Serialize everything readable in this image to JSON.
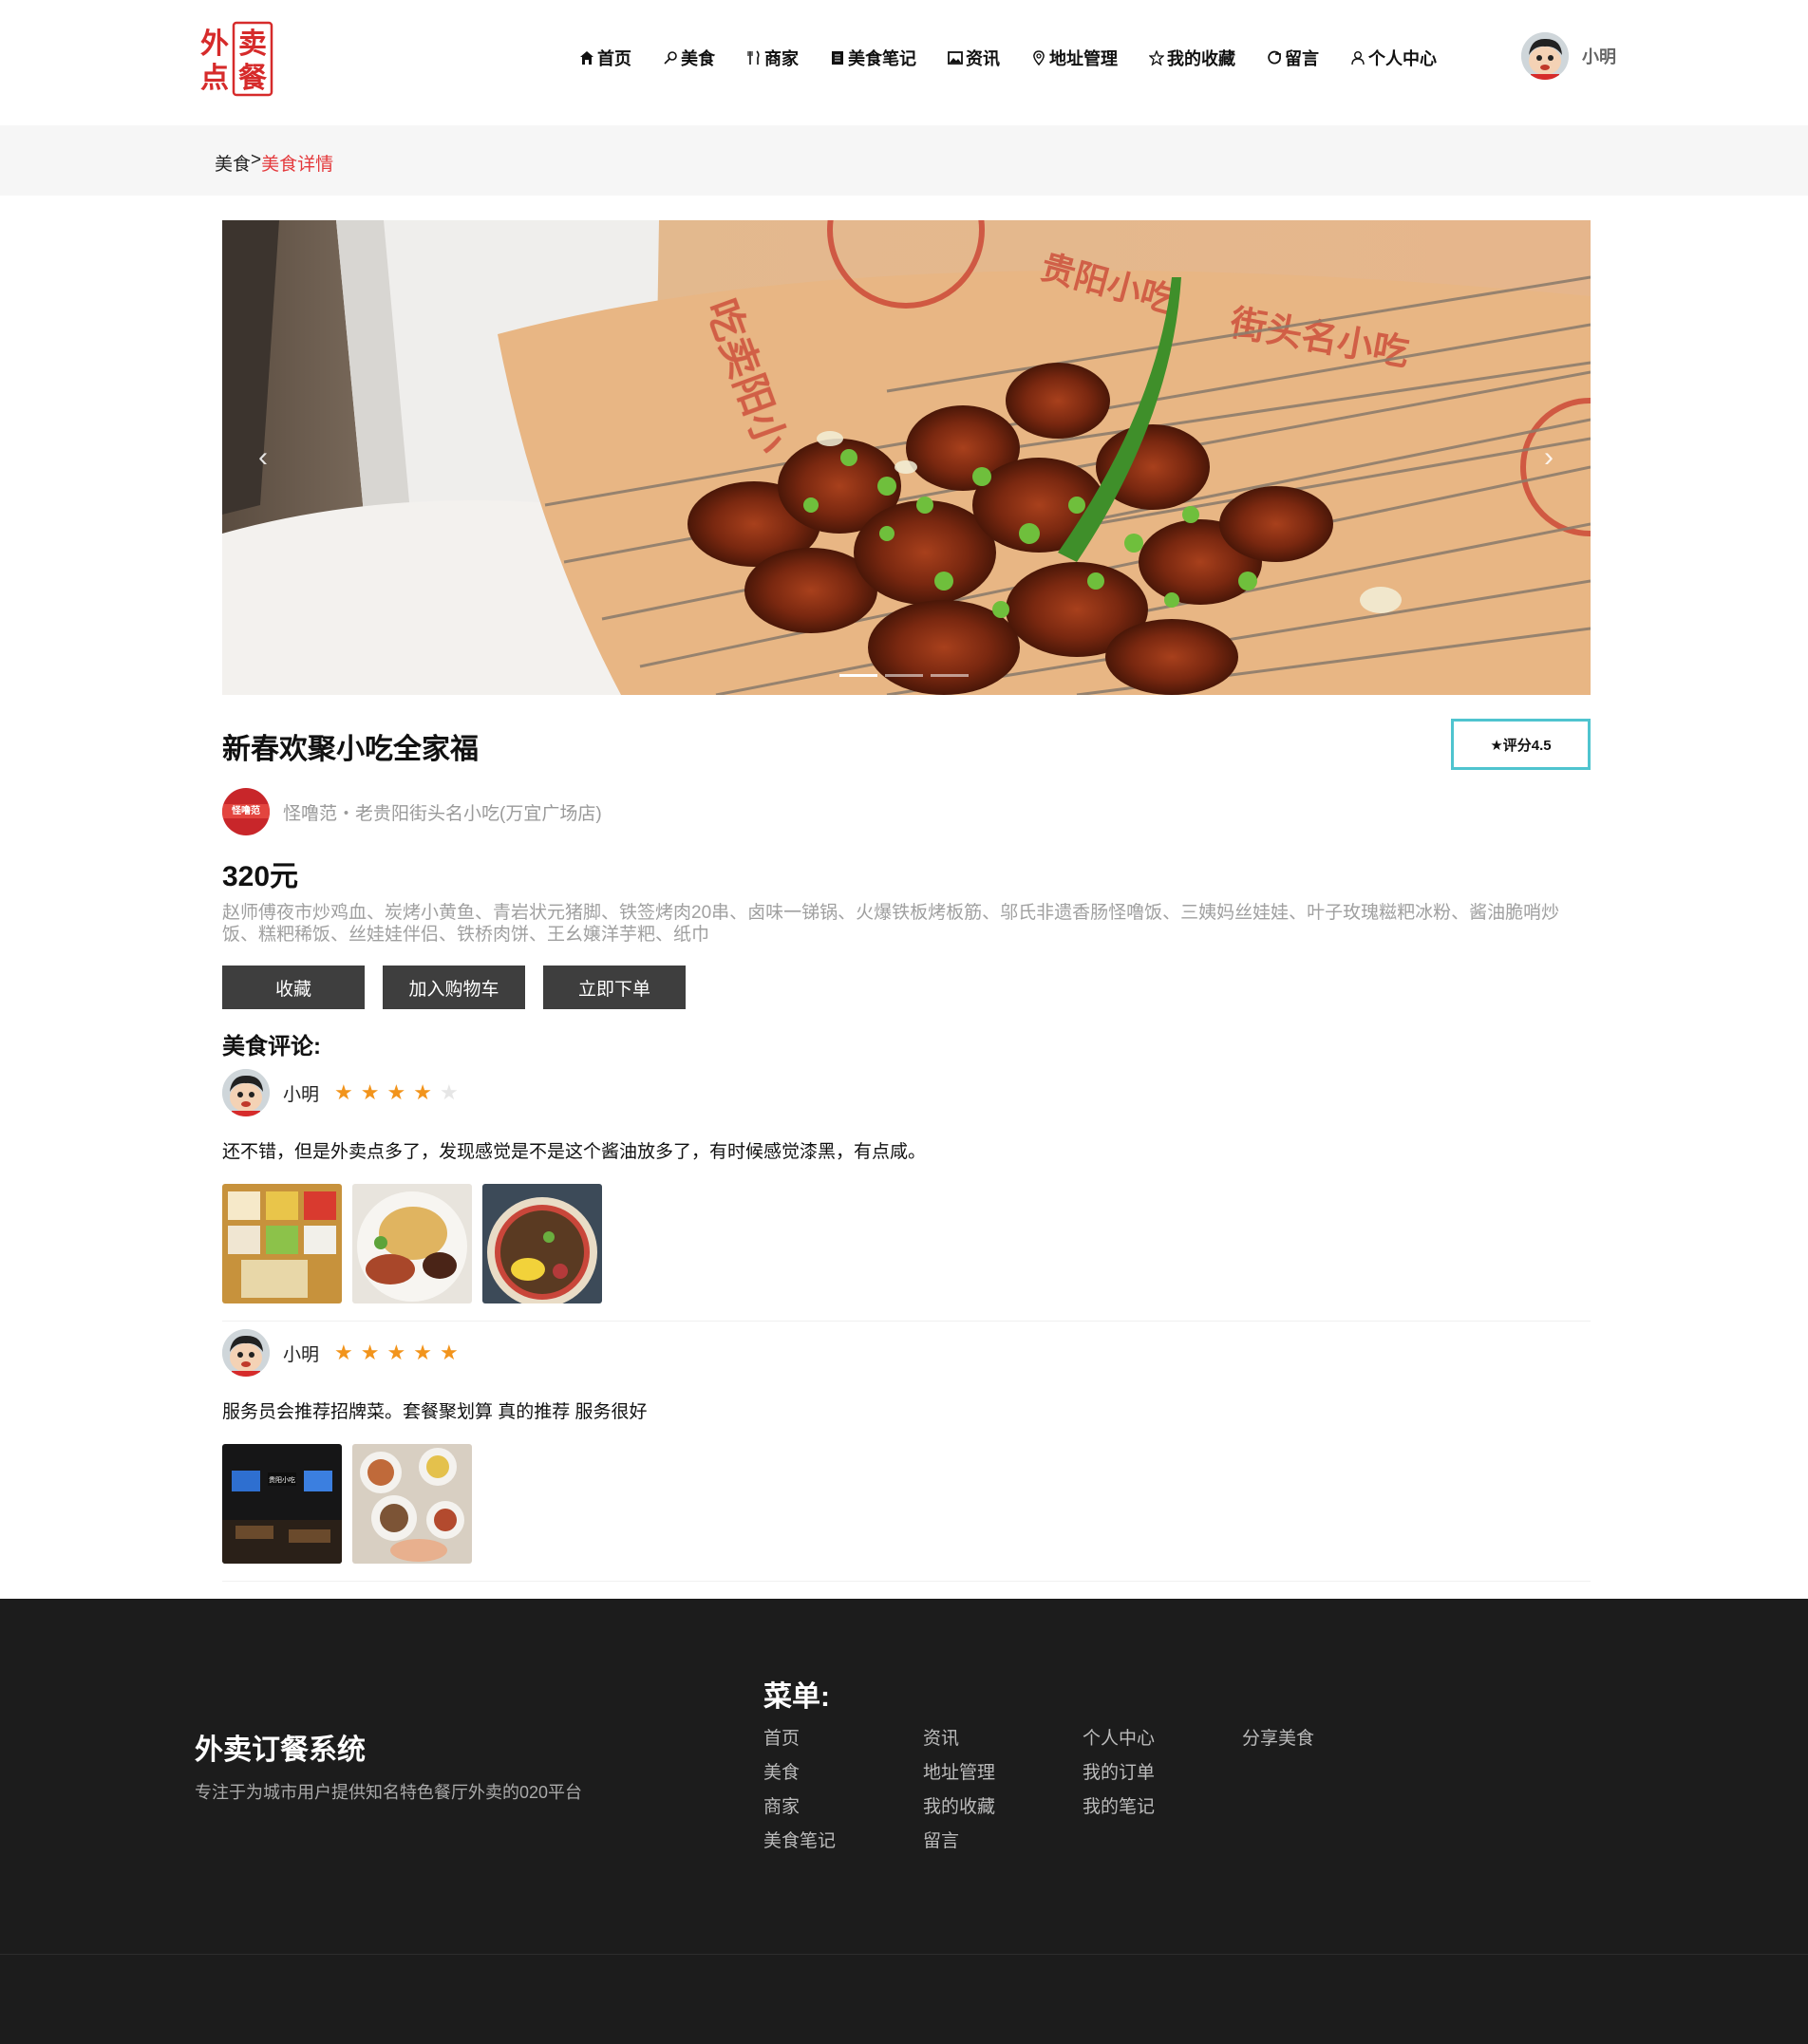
{
  "header": {
    "logo_text": "外卖点餐",
    "nav": [
      {
        "label": "首页",
        "icon": "home-icon"
      },
      {
        "label": "美食",
        "icon": "drumstick-icon"
      },
      {
        "label": "商家",
        "icon": "fork-knife-icon"
      },
      {
        "label": "美食笔记",
        "icon": "note-icon"
      },
      {
        "label": "资讯",
        "icon": "image-icon"
      },
      {
        "label": "地址管理",
        "icon": "location-pin-icon"
      },
      {
        "label": "我的收藏",
        "icon": "star-outline-icon"
      },
      {
        "label": "留言",
        "icon": "message-icon"
      },
      {
        "label": "个人中心",
        "icon": "user-icon"
      }
    ],
    "user_name": "小明"
  },
  "breadcrumb": {
    "parent": "美食",
    "separator": ">",
    "current": "美食详情"
  },
  "carousel": {
    "prev_label": "‹",
    "next_label": "›",
    "slide_count": 3,
    "active_index": 0
  },
  "product": {
    "title": "新春欢聚小吃全家福",
    "rating_label": "★评分4.5",
    "shop_name": "怪噜范・老贵阳街头名小吃(万宜广场店)",
    "shop_logo_text": "怪噜范",
    "price": "320元",
    "description": "赵师傅夜市炒鸡血、炭烤小黄鱼、青岩状元猪脚、铁签烤肉20串、卤味一锑锅、火爆铁板烤板筋、邬氏非遗香肠怪噜饭、三姨妈丝娃娃、叶子玫瑰糍粑冰粉、酱油脆哨炒饭、糕粑稀饭、丝娃娃伴侣、铁桥肉饼、王幺嬢洋芋粑、纸巾",
    "buttons": {
      "favorite": "收藏",
      "add_cart": "加入购物车",
      "order_now": "立即下单"
    }
  },
  "comments": {
    "title": "美食评论:",
    "items": [
      {
        "user": "小明",
        "stars": 4,
        "text": "还不错，但是外卖点多了，发现感觉是不是这个酱油放多了，有时候感觉漆黑，有点咸。",
        "images": [
          "side-dishes-photo",
          "fried-cake-photo",
          "rice-bowl-photo"
        ]
      },
      {
        "user": "小明",
        "stars": 5,
        "text": "服务员会推荐招牌菜。套餐聚划算 真的推荐 服务很好",
        "images": [
          "restaurant-interior-photo",
          "table-dishes-photo"
        ]
      }
    ]
  },
  "footer": {
    "brand": "外卖订餐系统",
    "slogan": "专注于为城市用户提供知名特色餐厅外卖的020平台",
    "menu_title": "菜单:",
    "menu_columns": [
      [
        "首页",
        "美食",
        "商家",
        "美食笔记"
      ],
      [
        "资讯",
        "地址管理",
        "我的收藏",
        "留言"
      ],
      [
        "个人中心",
        "我的订单",
        "我的笔记"
      ],
      [
        "分享美食"
      ]
    ]
  },
  "colors": {
    "accent_red": "#e4393c",
    "rating_border": "#4fc4cf",
    "star": "#f2941c",
    "button_bg": "#3e3e3e",
    "footer_bg": "#1c1c1c"
  }
}
